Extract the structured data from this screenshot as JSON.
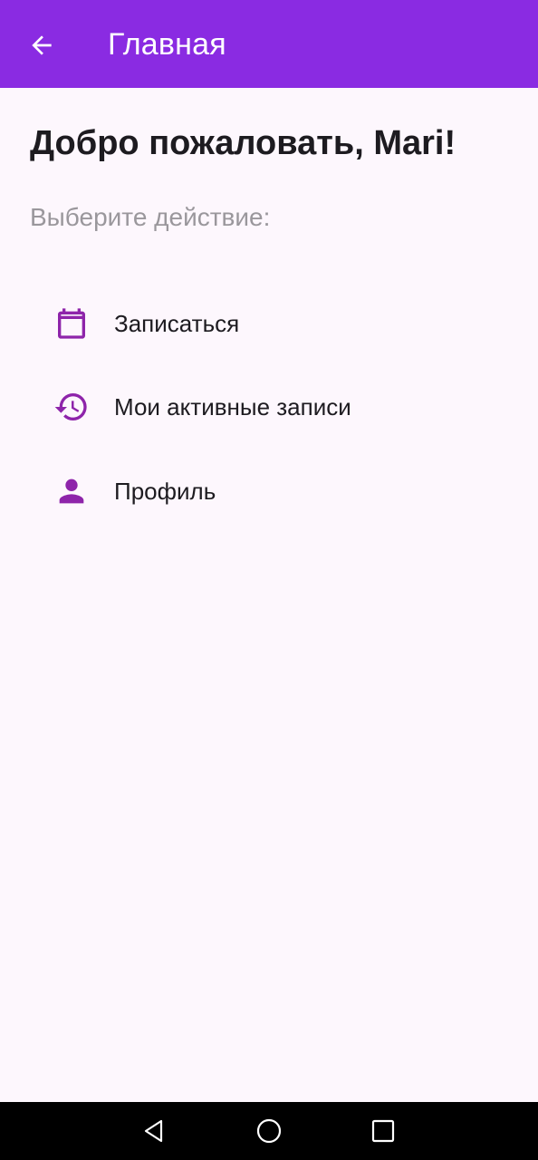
{
  "app_bar": {
    "title": "Главная",
    "back_icon": "arrow-back-icon",
    "background_color": "#8a2be2"
  },
  "main": {
    "welcome": "Добро пожаловать, Mari!",
    "subtitle": "Выберите действие:",
    "menu_items": [
      {
        "label": "Записаться",
        "icon": "calendar-icon"
      },
      {
        "label": "Мои активные записи",
        "icon": "history-icon"
      },
      {
        "label": "Профиль",
        "icon": "person-icon"
      }
    ],
    "icon_color": "#8e24aa"
  },
  "system_nav": {
    "icons": [
      "nav-back-icon",
      "nav-home-icon",
      "nav-recents-icon"
    ]
  }
}
